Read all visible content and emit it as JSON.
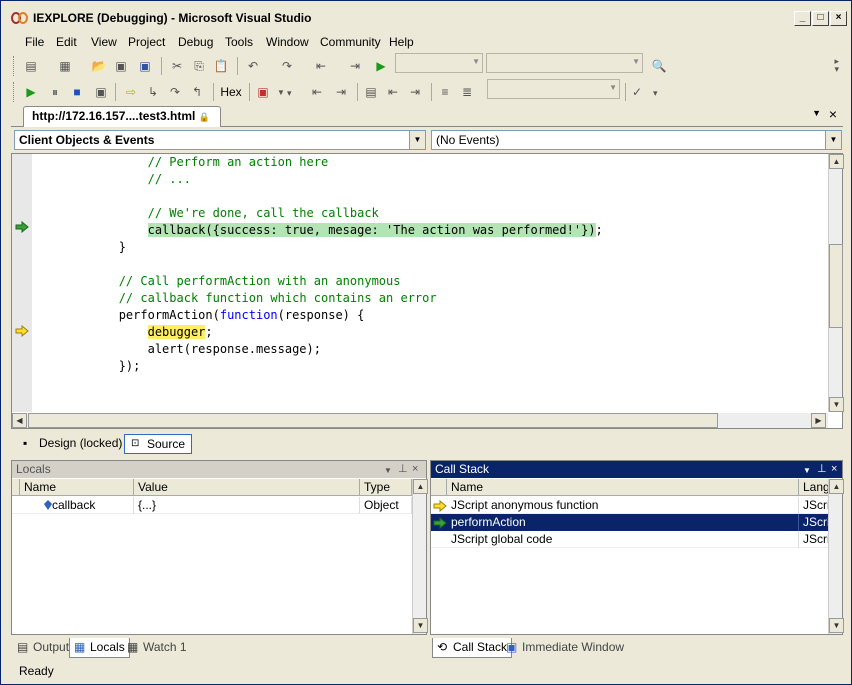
{
  "window": {
    "title": "IEXPLORE (Debugging) - Microsoft Visual Studio"
  },
  "menu": [
    "File",
    "Edit",
    "View",
    "Project",
    "Debug",
    "Tools",
    "Window",
    "Community",
    "Help"
  ],
  "toolbar2": {
    "hex_label": "Hex"
  },
  "doc_tab": {
    "label": "http://172.16.157....test3.html"
  },
  "dropdowns": {
    "left": "Client Objects & Events",
    "right": "(No Events)"
  },
  "code_lines": [
    {
      "indent": "                ",
      "parts": [
        {
          "t": "// Perform an action here",
          "c": "cmt"
        }
      ]
    },
    {
      "indent": "                ",
      "parts": [
        {
          "t": "// ...",
          "c": "cmt"
        }
      ]
    },
    {
      "indent": "",
      "parts": []
    },
    {
      "indent": "                ",
      "parts": [
        {
          "t": "// We're done, call the callback",
          "c": "cmt"
        }
      ]
    },
    {
      "indent": "                ",
      "parts": [
        {
          "t": "callback({success: true, mesage: ",
          "c": "hl-green"
        },
        {
          "t": "'The action was performed!'",
          "c": "hl-green"
        },
        {
          "t": "});",
          "c": "hl-green"
        },
        {
          "t": ";",
          "c": ""
        }
      ]
    },
    {
      "indent": "            ",
      "parts": [
        {
          "t": "}",
          "c": ""
        }
      ]
    },
    {
      "indent": "",
      "parts": []
    },
    {
      "indent": "            ",
      "parts": [
        {
          "t": "// Call performAction with an anonymous",
          "c": "cmt"
        }
      ]
    },
    {
      "indent": "            ",
      "parts": [
        {
          "t": "// callback function which contains an error",
          "c": "cmt"
        }
      ]
    },
    {
      "indent": "            ",
      "parts": [
        {
          "t": "performAction(",
          "c": ""
        },
        {
          "t": "function",
          "c": "kw"
        },
        {
          "t": "(response) {",
          "c": ""
        }
      ]
    },
    {
      "indent": "                ",
      "parts": [
        {
          "t": "debugger",
          "c": "hl-yellow"
        },
        {
          "t": ";",
          "c": ""
        }
      ]
    },
    {
      "indent": "                ",
      "parts": [
        {
          "t": "alert(response.message);",
          "c": ""
        }
      ]
    },
    {
      "indent": "            ",
      "parts": [
        {
          "t": "});",
          "c": ""
        }
      ]
    }
  ],
  "view_buttons": {
    "design": "Design (locked)",
    "source": "Source"
  },
  "locals": {
    "title": "Locals",
    "columns": [
      "Name",
      "Value",
      "Type"
    ],
    "rows": [
      {
        "name": "callback",
        "value": "{...}",
        "type": "Object"
      }
    ]
  },
  "callstack": {
    "title": "Call Stack",
    "columns": [
      "Name",
      "Language"
    ],
    "language_shown": "Langu",
    "rows": [
      {
        "name": "JScript anonymous function",
        "lang": "JScrip",
        "marker": "current"
      },
      {
        "name": "performAction",
        "lang": "JScrip",
        "marker": "caller"
      },
      {
        "name": "JScript global code",
        "lang": "JScrip",
        "marker": ""
      }
    ]
  },
  "left_tabs": [
    "Output",
    "Locals",
    "Watch 1"
  ],
  "right_tabs": [
    "Call Stack",
    "Immediate Window"
  ],
  "status": "Ready",
  "colors": {
    "selection": "#0a246a",
    "highlight_green": "#b4e4b4",
    "highlight_yellow": "#ffee62",
    "comment": "#008000",
    "keyword": "#0000ff"
  }
}
